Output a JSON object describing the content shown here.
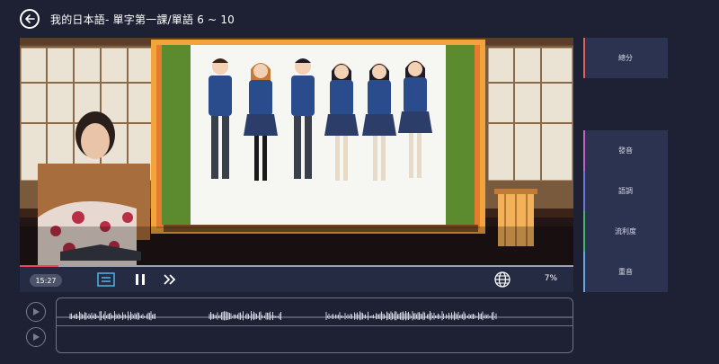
{
  "header": {
    "title": "我的日本語- 單字第一課/單語 6 ~ 10"
  },
  "player": {
    "time": "15:27",
    "progress": 0.07,
    "percent_label": "7%"
  },
  "scores": [
    {
      "label": "總分",
      "color": "#e0605e"
    },
    {
      "label": "發音",
      "color": "#c760c9"
    },
    {
      "label": "語調",
      "color": "#6b78e0"
    },
    {
      "label": "流利度",
      "color": "#47b36b"
    },
    {
      "label": "重音",
      "color": "#6aa7e6"
    }
  ],
  "icons": {
    "back": "arrow-left-icon",
    "subtitle": "subtitles-icon",
    "pause": "pause-icon",
    "next": "fast-forward-icon",
    "language": "globe-icon",
    "play_original": "play-icon",
    "play_recording": "play-icon"
  },
  "colors": {
    "background": "#1d2133",
    "accent": "#e7475e",
    "panel": "#2c3350"
  }
}
